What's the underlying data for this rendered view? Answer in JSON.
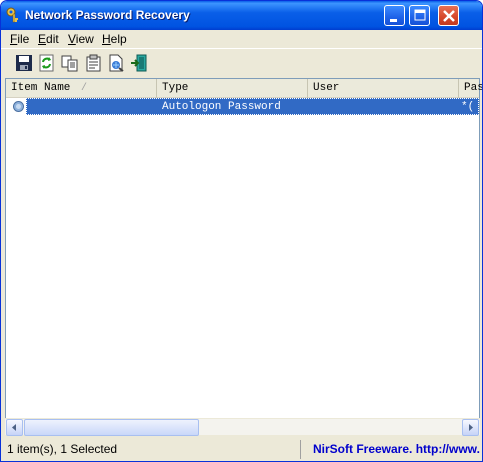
{
  "window": {
    "title": "Network Password Recovery"
  },
  "menu": {
    "items": [
      {
        "label_ul": "F",
        "label_rest": "ile"
      },
      {
        "label_ul": "E",
        "label_rest": "dit"
      },
      {
        "label_ul": "V",
        "label_rest": "iew"
      },
      {
        "label_ul": "H",
        "label_rest": "elp"
      }
    ]
  },
  "toolbar": {
    "buttons": [
      "save-icon",
      "refresh-icon",
      "copy-icon",
      "properties-icon",
      "html-report-icon",
      "exit-icon"
    ]
  },
  "list": {
    "columns": [
      "Item Name",
      "Type",
      "User",
      "Pas"
    ],
    "sort_indicator": "/",
    "rows": [
      {
        "item_name": "",
        "type": "Autologon Password",
        "user": "",
        "password": "*("
      }
    ]
  },
  "status": {
    "count_text": "1 item(s), 1 Selected",
    "credit_text": "NirSoft Freeware.  http://www."
  },
  "colors": {
    "title_bar": "#0a5fe8",
    "selection": "#316ac5",
    "credit": "#0000cc"
  }
}
